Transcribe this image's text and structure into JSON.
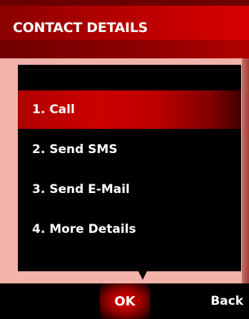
{
  "header": {
    "title": "CONTACT DETAILS"
  },
  "menu": {
    "items": [
      {
        "label": "1. Call",
        "selected": true
      },
      {
        "label": "2. Send SMS",
        "selected": false
      },
      {
        "label": "3. Send E-Mail",
        "selected": false
      },
      {
        "label": "4. More Details",
        "selected": false
      }
    ]
  },
  "softkeys": {
    "ok_label": "OK",
    "back_label": "Back"
  },
  "colors": {
    "accent": "#cc0000",
    "content_bg": "#f2b3aa",
    "popup_bg": "#000000"
  }
}
